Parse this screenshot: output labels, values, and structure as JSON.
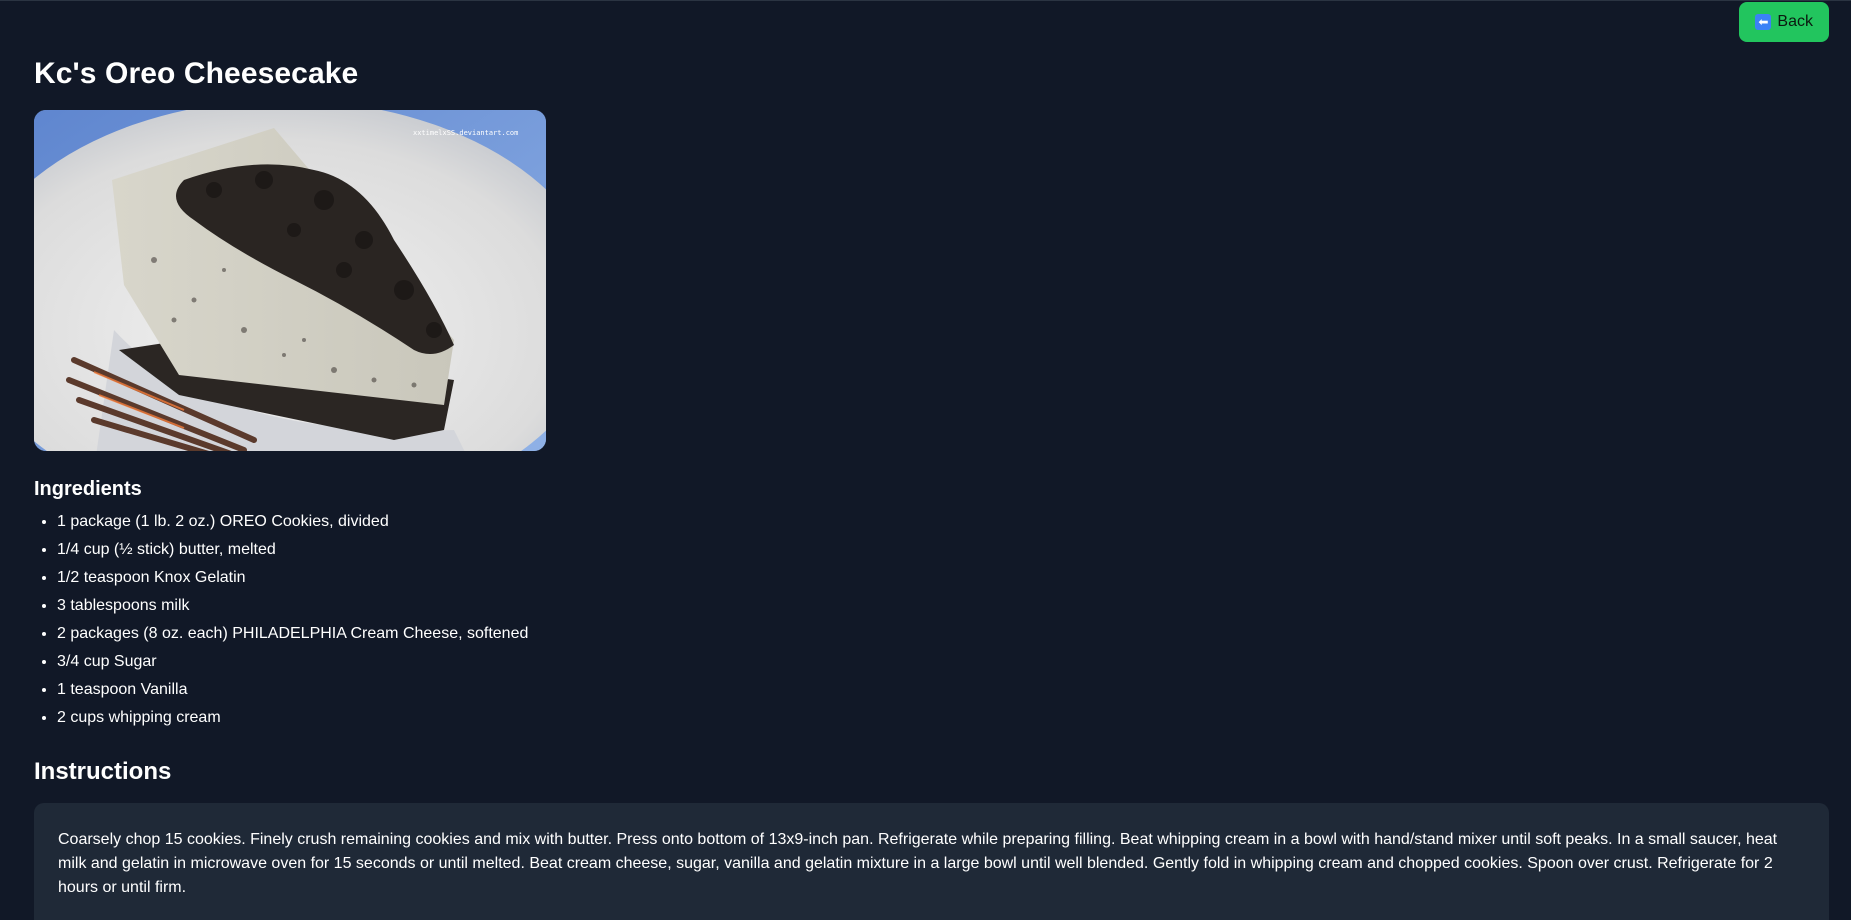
{
  "header": {
    "back_label": "Back",
    "back_icon": "left-arrow-icon"
  },
  "recipe": {
    "title": "Kc's Oreo Cheesecake",
    "image_watermark": "xxtimelxSS.deviantart.com",
    "ingredients_heading": "Ingredients",
    "ingredients": [
      "1 package (1 lb. 2 oz.) OREO Cookies, divided",
      "1/4 cup (½ stick) butter, melted",
      "1/2 teaspoon Knox Gelatin",
      "3 tablespoons milk",
      "2 packages (8 oz. each) PHILADELPHIA Cream Cheese, softened",
      "3/4 cup Sugar",
      "1 teaspoon Vanilla",
      "2 cups whipping cream"
    ],
    "instructions_heading": "Instructions",
    "instructions": "Coarsely chop 15 cookies. Finely crush remaining cookies and mix with butter. Press onto bottom of 13x9-inch pan. Refrigerate while preparing filling. Beat whipping cream in a bowl with hand/stand mixer until soft peaks. In a small saucer, heat milk and gelatin in microwave oven for 15 seconds or until melted. Beat cream cheese, sugar, vanilla and gelatin mixture in a large bowl until well blended. Gently fold in whipping cream and chopped cookies. Spoon over crust. Refrigerate for 2 hours or until firm."
  },
  "colors": {
    "background": "#111827",
    "panel": "#1f2937",
    "accent_button": "#22c55e",
    "icon_blue": "#3b82f6"
  }
}
